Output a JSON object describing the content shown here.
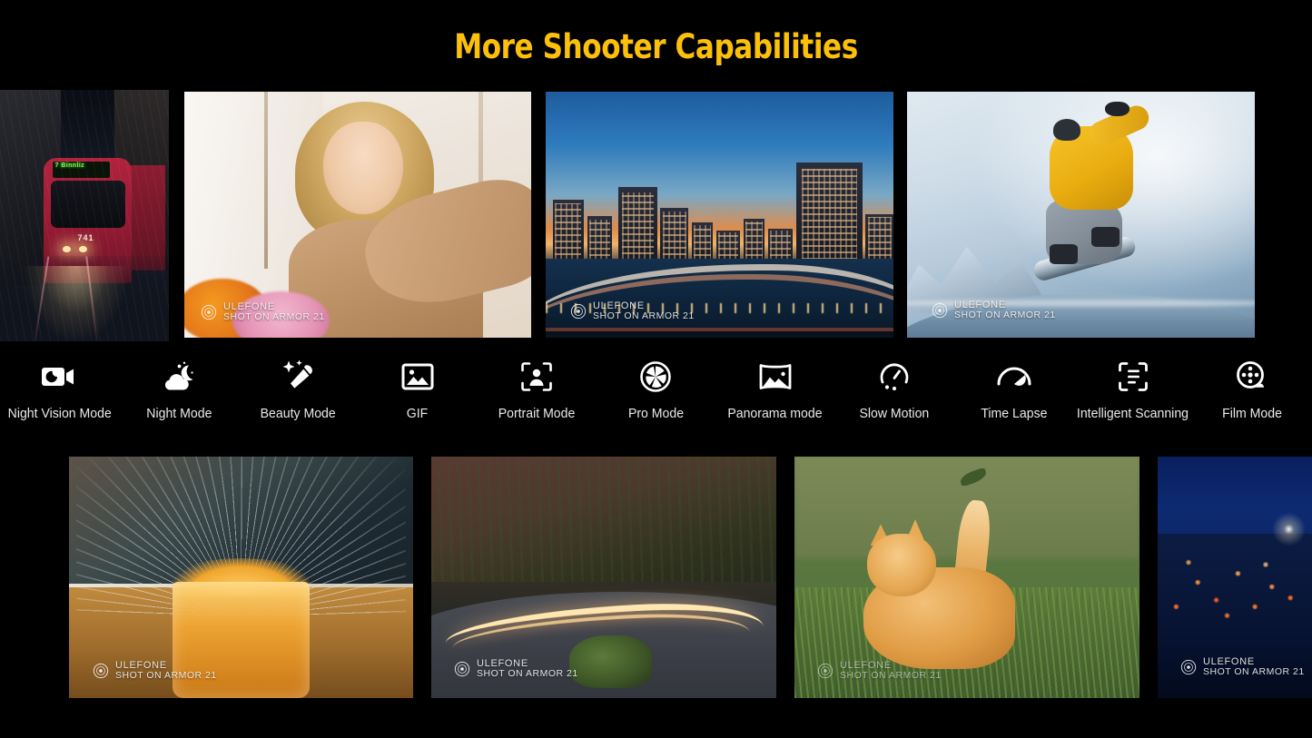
{
  "page": {
    "title": "More Shooter Capabilities",
    "title_color": "#FCC00A",
    "background_color": "#000000"
  },
  "watermark": {
    "brand": "ULEFONE",
    "caption": "SHOT ON ARMOR 21",
    "icon": "lens-logo-icon"
  },
  "top_gallery": [
    {
      "name": "night-tram-photo",
      "subject": "Red tram on wet street at night in the rain",
      "destination_sign": "7 Binnliz",
      "vehicle_number": "741",
      "has_watermark": false
    },
    {
      "name": "selfie-portrait-photo",
      "subject": "Blonde woman taking a selfie with flowers in foreground",
      "has_watermark": true
    },
    {
      "name": "city-dusk-photo",
      "subject": "City skyline at dusk with curving elevated highway over water",
      "has_watermark": true
    },
    {
      "name": "snowboarder-photo",
      "subject": "Snowboarder in yellow jacket mid-air over snowy ridge",
      "has_watermark": true
    }
  ],
  "modes": [
    {
      "label": "Night Vision Mode",
      "icon": "night-vision-camera-icon"
    },
    {
      "label": "Night Mode",
      "icon": "moon-cloud-icon"
    },
    {
      "label": "Beauty Mode",
      "icon": "makeup-brush-sparkle-icon"
    },
    {
      "label": "GIF",
      "icon": "picture-frame-icon"
    },
    {
      "label": "Portrait Mode",
      "icon": "person-focus-frame-icon"
    },
    {
      "label": "Pro Mode",
      "icon": "camera-aperture-icon"
    },
    {
      "label": "Panorama mode",
      "icon": "panorama-landscape-icon"
    },
    {
      "label": "Slow Motion",
      "icon": "slow-speedometer-icon"
    },
    {
      "label": "Time Lapse",
      "icon": "speedometer-needle-icon"
    },
    {
      "label": "Intelligent Scanning",
      "icon": "document-scan-frame-icon"
    },
    {
      "label": "Film Mode",
      "icon": "film-reel-icon"
    }
  ],
  "bottom_gallery": [
    {
      "name": "drink-splash-photo",
      "subject": "High-speed splash of orange drink in a glass",
      "has_watermark": true
    },
    {
      "name": "light-trails-road-photo",
      "subject": "Long-exposure car light trails on a desert mountain road at dusk",
      "has_watermark": true
    },
    {
      "name": "playing-cat-photo",
      "subject": "Orange tabby cat reaching up at a falling leaf in grass",
      "has_watermark": true
    },
    {
      "name": "night-cityscape-photo",
      "subject": "Night cityscape with red lights under a deep blue sky",
      "has_watermark": true
    }
  ]
}
